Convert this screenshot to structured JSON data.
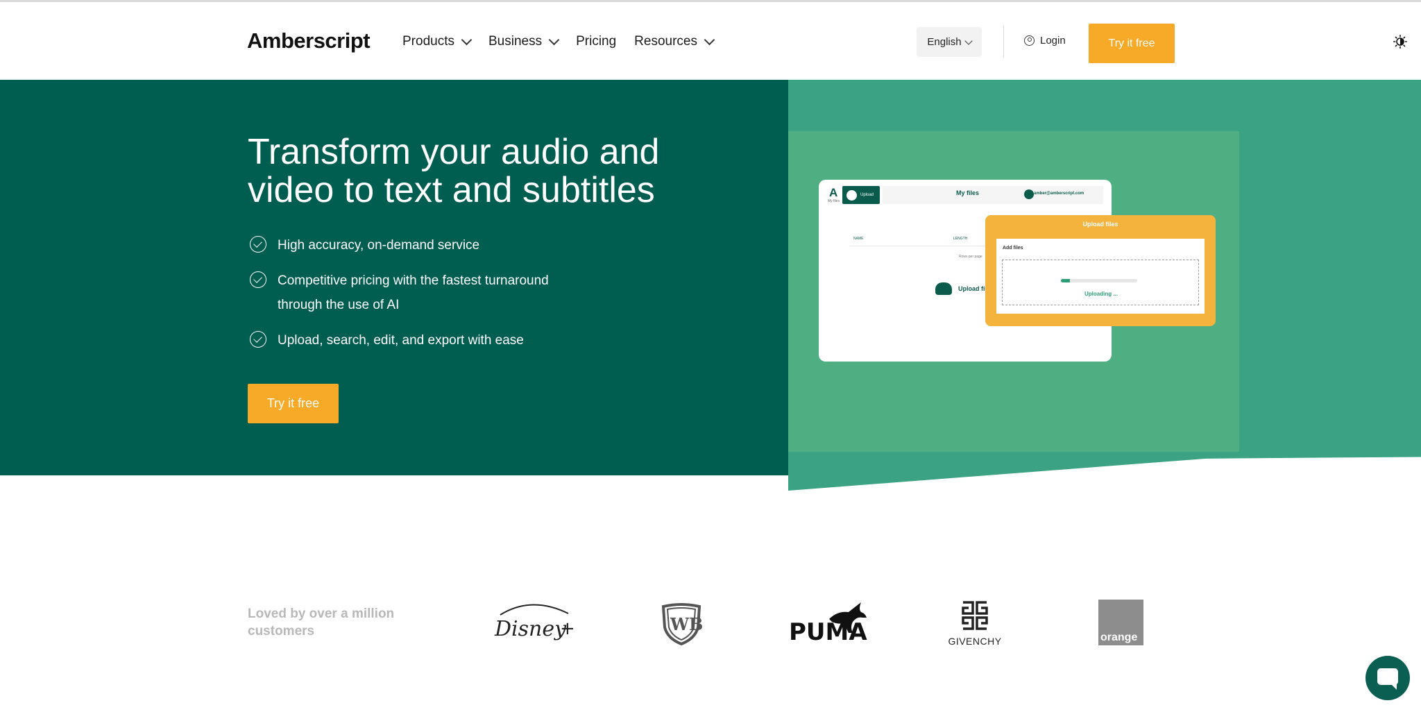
{
  "header": {
    "logo": "Amberscript",
    "nav": [
      {
        "label": "Products",
        "has_dropdown": true
      },
      {
        "label": "Business",
        "has_dropdown": true
      },
      {
        "label": "Pricing",
        "has_dropdown": false
      },
      {
        "label": "Resources",
        "has_dropdown": true
      }
    ],
    "language": "English",
    "login": "Login",
    "cta": "Try it free",
    "theme_icon": "theme-toggle-icon"
  },
  "hero": {
    "title_line1": "Transform your audio and",
    "title_line2": "video to text and subtitles",
    "bullets": [
      "High accuracy, on-demand service",
      "Competitive pricing with the fastest turnaround through the use of AI",
      "Upload, search, edit, and export with ease"
    ],
    "cta": "Try it free"
  },
  "mockup": {
    "logo": "A",
    "logo_sub": "My files",
    "upload_button": "Upload",
    "page_title": "My files",
    "email": "amber@amberscript.com",
    "col_name": "NAME",
    "col_length": "LENGTH",
    "rows_per_page": "Rows per page",
    "upload_file": "Upload fil",
    "modal_title": "Upload files",
    "add_files": "Add files",
    "uploading": "Uploading ...",
    "progress": 0.12
  },
  "logos": {
    "tagline": "Loved by over a million customers",
    "brands": [
      "Disney+",
      "WB",
      "PUMA",
      "GIVENCHY",
      "orange"
    ]
  },
  "colors": {
    "hero_dark": "#005e50",
    "hero_mid": "#3ba384",
    "hero_inner": "#4faf83",
    "accent": "#f7a928"
  },
  "chat": {
    "icon": "chat-icon"
  }
}
